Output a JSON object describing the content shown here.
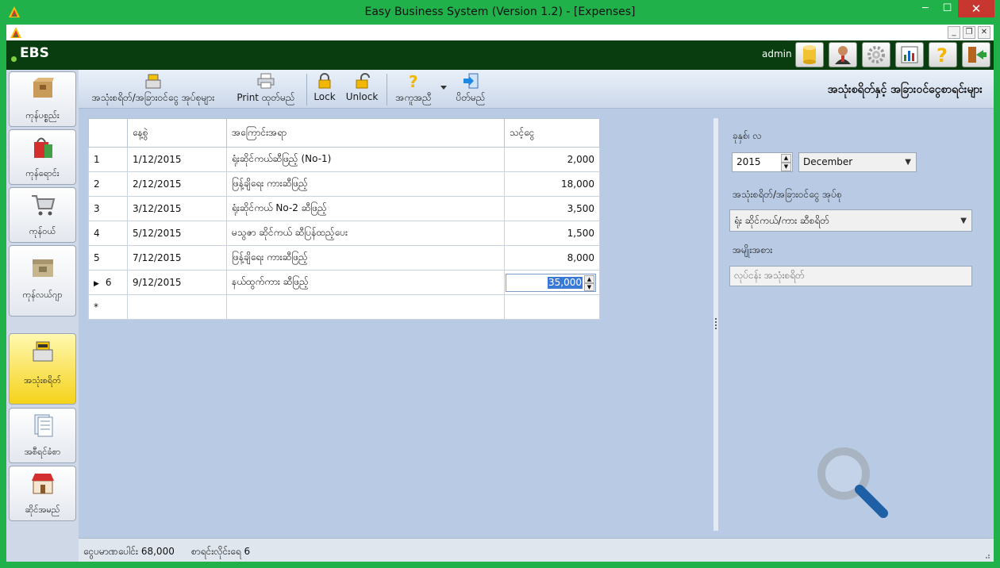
{
  "window": {
    "title": "Easy Business System  (Version 1.2) - [Expenses]",
    "min": "─",
    "max": "☐",
    "close": "✕"
  },
  "mdi": {
    "min": "_",
    "restore": "❐",
    "close": "✕"
  },
  "header": {
    "logo": "EBS",
    "user": "admin"
  },
  "sidebar": {
    "items": [
      {
        "label": "ကုန်ပစ္စည်း"
      },
      {
        "label": "ကုန်ရောင်း"
      },
      {
        "label": "ကုန်ဝယ်"
      },
      {
        "label": "ကုန်လယ်ဂျာ"
      },
      {
        "label": "အသုံးစရိတ်"
      },
      {
        "label": "အစီရင်ခံစာ"
      },
      {
        "label": "ဆိုင်အမည်"
      }
    ]
  },
  "toolbar": {
    "expense_types": "အသုံးစရိတ်/အခြားဝင်ငွေ အုပ်စုများ",
    "print": "Print ထုတ်မည်",
    "lock": "Lock",
    "unlock": "Unlock",
    "help": "အကူအညီ",
    "close": "ပိတ်မည်",
    "page_title": "အသုံးစရိတ်နှင့် အခြားဝင်ငွေစာရင်းများ"
  },
  "grid": {
    "columns": [
      "နေ့စွဲ",
      "အကြောင်းအရာ",
      "သင့်ငွေ"
    ],
    "rows": [
      {
        "no": "1",
        "date": "1/12/2015",
        "desc": "ရုံးဆိုင်ကယ်ဆီဖြည့် (No-1)",
        "amount": "2,000"
      },
      {
        "no": "2",
        "date": "2/12/2015",
        "desc": "ဖြန့်ချိရေး ကားဆီဖြည့်",
        "amount": "18,000"
      },
      {
        "no": "3",
        "date": "3/12/2015",
        "desc": "ရုံးဆိုင်ကယ် No-2 ဆီဖြည့်",
        "amount": "3,500"
      },
      {
        "no": "4",
        "date": "5/12/2015",
        "desc": "မသွဇာ ဆိုင်ကယ် ဆီပြန်ထည့်ပေး",
        "amount": "1,500"
      },
      {
        "no": "5",
        "date": "7/12/2015",
        "desc": "ဖြန့်ချိရေး ကားဆီဖြည့်",
        "amount": "8,000"
      },
      {
        "no": "6",
        "date": "9/12/2015",
        "desc": "နယ်ထွက်ကား ဆီဖြည့်",
        "amount": "35,000"
      }
    ],
    "current_marker": "▶",
    "new_row_marker": "*"
  },
  "filter": {
    "period_label": "ခုနှစ်၊ လ",
    "year": "2015",
    "month": "December",
    "group_label": "အသုံးစရိတ်/အခြားဝင်ငွေ အုပ်စု",
    "group_value": "ရုံး ဆိုင်ကယ်/ကား ဆီစရိတ်",
    "type_label": "အမျိုးအစား",
    "type_value": "လုပ်ငန်း အသုံးစရိတ်"
  },
  "status": {
    "total": "ငွေပမာဏပေါင်း 68,000",
    "count": "စာရင်းလိုင်းရေ 6"
  }
}
